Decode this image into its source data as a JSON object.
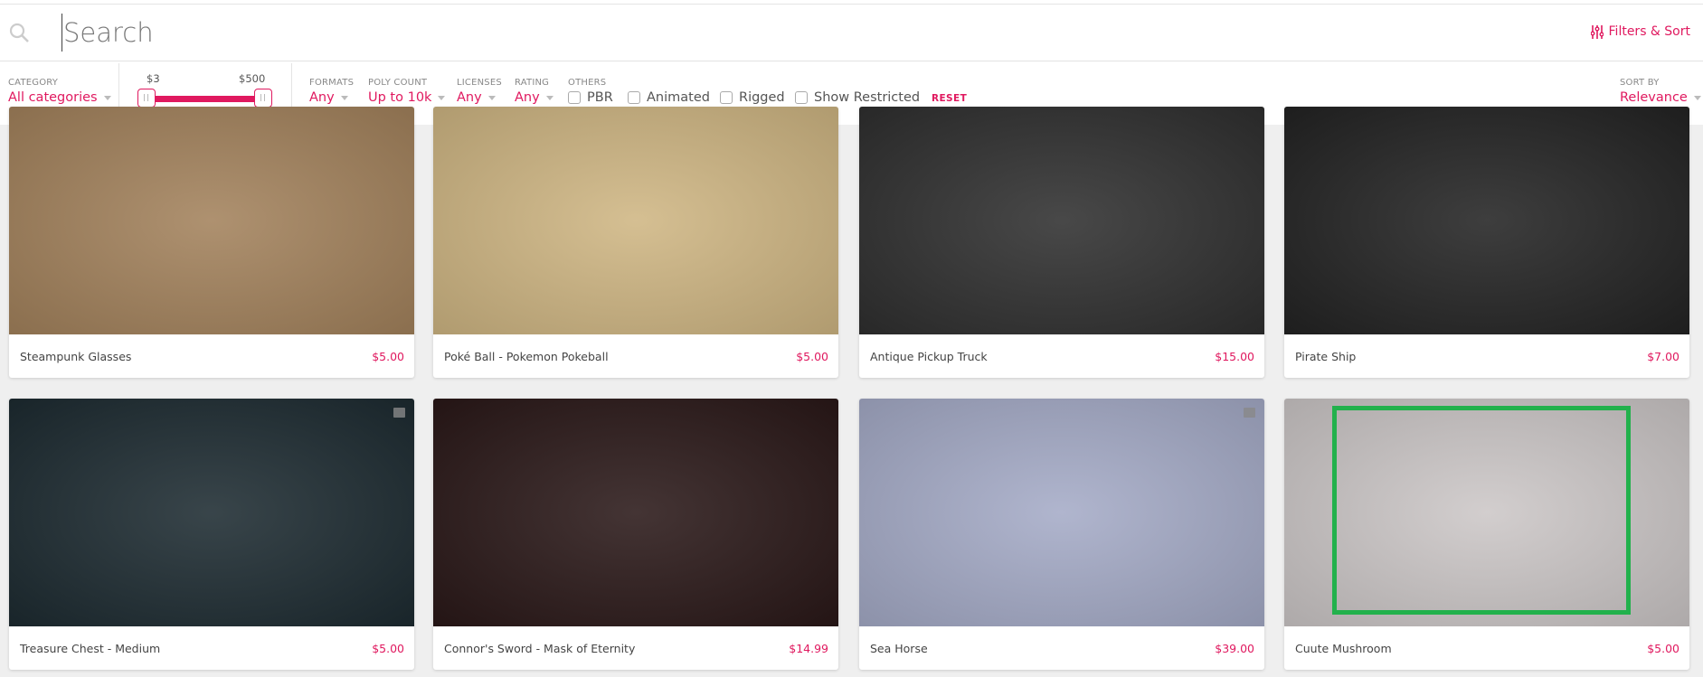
{
  "search": {
    "placeholder": "Search",
    "filters_sort_label": "Filters & Sort"
  },
  "filters": {
    "category": {
      "label": "CATEGORY",
      "value": "All categories"
    },
    "price": {
      "min": "$3",
      "max": "$500"
    },
    "formats": {
      "label": "FORMATS",
      "value": "Any"
    },
    "poly_count": {
      "label": "POLY COUNT",
      "value": "Up to 10k"
    },
    "licenses": {
      "label": "LICENSES",
      "value": "Any"
    },
    "rating": {
      "label": "RATING",
      "value": "Any"
    },
    "others": {
      "label": "OTHERS",
      "options": [
        "PBR",
        "Animated",
        "Rigged",
        "Show Restricted"
      ]
    },
    "reset_label": "RESET",
    "sort": {
      "label": "SORT BY",
      "value": "Relevance"
    }
  },
  "accent": "#e0195f",
  "cards": [
    {
      "title": "Steampunk Glasses",
      "price": "$5.00",
      "bg": "#a3825c"
    },
    {
      "title": "Poké Ball - Pokemon Pokeball",
      "price": "$5.00",
      "bg": "#cfb683"
    },
    {
      "title": "Antique Pickup Truck",
      "price": "$15.00",
      "bg": "#2f2f2f"
    },
    {
      "title": "Pirate Ship",
      "price": "$7.00",
      "bg": "#232323"
    },
    {
      "title": "Treasure Chest - Medium",
      "price": "$5.00",
      "bg": "#1d2b31"
    },
    {
      "title": "Connor's Sword - Mask of Eternity",
      "price": "$14.99",
      "bg": "#2a1818"
    },
    {
      "title": "Sea Horse",
      "price": "$39.00",
      "bg": "#a5abc7"
    },
    {
      "title": "Cuute Mushroom",
      "price": "$5.00",
      "bg": "#ccc7c7"
    }
  ]
}
